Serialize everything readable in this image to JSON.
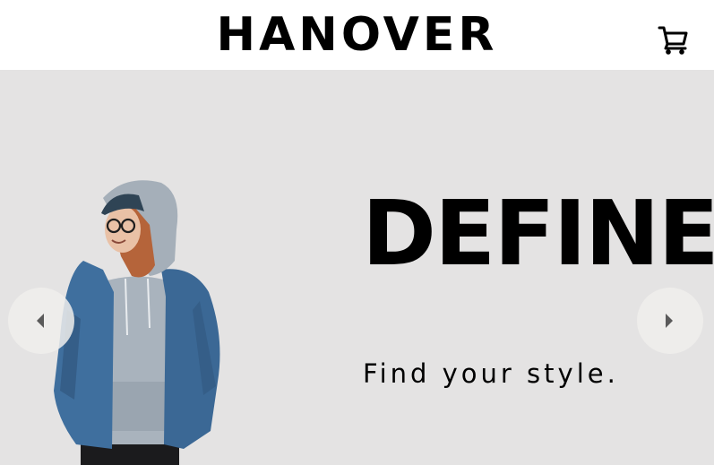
{
  "header": {
    "brand": "HANOVER",
    "cart_icon": "shopping-cart-icon"
  },
  "hero": {
    "headline": "DEFINE",
    "tagline": "Find your style.",
    "prev_icon": "caret-left-icon",
    "next_icon": "caret-right-icon",
    "background": "#e4e3e3"
  },
  "colors": {
    "denim": "#3f6f9e",
    "hoodie": "#a9b3bd",
    "hair": "#b5643a"
  }
}
